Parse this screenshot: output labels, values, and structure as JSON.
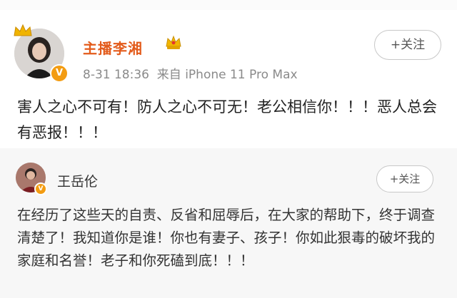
{
  "post1": {
    "author_name": "主播李湘",
    "verified_badge": "V",
    "date": "8-31 18:36",
    "source": "来自 iPhone 11 Pro Max",
    "follow_label": "+关注",
    "text": "害人之心不可有！防人之心不可无！老公相信你！！！恶人总会有恶报！！！"
  },
  "post2": {
    "author_name": "王岳伦",
    "verified_badge": "V",
    "follow_label": "+关注",
    "text": "在经历了这些天的自责、反省和屈辱后，在大家的帮助下，终于调查清楚了！我知道你是谁！你也有妻子、孩子！你如此狠毒的破坏我的家庭和名誉！老子和你死磕到底！！！"
  },
  "icons": [
    "crown-icon",
    "vip-crown-icon",
    "verified-icon"
  ],
  "colors": {
    "name_accent": "#e35b1b",
    "badge": "#f39c12",
    "meta": "#8a8a8a"
  }
}
